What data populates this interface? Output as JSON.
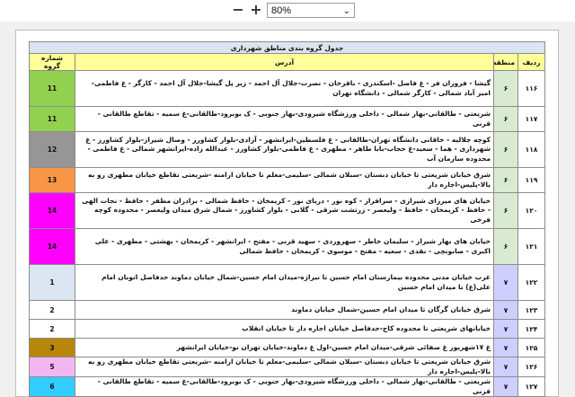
{
  "toolbar": {
    "zoom_out": "−",
    "zoom_in": "+",
    "zoom_value": "80%",
    "caret": "⌄"
  },
  "table": {
    "title": "جدول گروه بندی مناطق شهرداری",
    "headers": {
      "row": "ردیف",
      "region": "منطقه",
      "address": "آدرس",
      "group": "شماره گروه"
    },
    "rows": [
      {
        "code": "۱۱۶",
        "region": "۶",
        "address": "گیشا - فروزان فر - غ فاضل -اسکندری - باقرخان - نصرت-جلال آل احمد - زیر پل گیشا-جلال آل احمد - کارگر - غ فاطمی-امیر آباد شمالی - کارگر شمالی - دانشگاه تهران",
        "group": "11",
        "color": "#92d050",
        "regionColor": "#d9ead3"
      },
      {
        "code": "۱۱۷",
        "region": "۶",
        "address": "شریعتی - طالقانی-بهار شمالی - داخلی ورزشگاه شیرودی-بهار جنوبی - ک بوبرود-طالقانی-غ سمیه - تقاطع طالقانی - قرنی",
        "group": "11",
        "color": "#92d050",
        "regionColor": "#d9ead3"
      },
      {
        "code": "۱۱۸",
        "region": "۶",
        "address": "کوچه جلالیه - خاقانی دانشگاه تهران-طالقانی - غ فلسطین-ایرانشهر - آزادی-بلوار کشاورز - وصال شیراز-بلوار کشاورز - غ شهرداری - هما - سعید-غ حجاب-بابا طاهر - مطهری - غ فاطمی-بلوار کشاورز - عبدالله زاده-ایرانشهر شمالی - غ فاطمی - محدوده سازمان آب",
        "group": "12",
        "color": "#969696",
        "regionColor": "#d9ead3"
      },
      {
        "code": "۱۱۹",
        "region": "۶",
        "address": "شرق خیابان شریعتی تا خیابان دبستان -سبلان شمالی -سلیمی-معلم تا خیابان ارامنه -شریعتی تقاطع خیابان مطهری رو به بالا-پلیس-اجاره دار",
        "group": "13",
        "color": "#f79646",
        "regionColor": "#d9ead3"
      },
      {
        "code": "۱۲۰",
        "region": "۶",
        "address": "خیابان های میرزای شیرازی - سرافراز - کوه نور - دریای نور - کریمخان - حافظ شمالی - برادران مظفر - حافظ - نجات الهی - حافظ - کریمخان - حافظ - ولیعصر - زرتشت شرقی - گلابی - بلوار کشاورز - شمال شرق میدان ولیعصر - محدوده کوچه فرخی",
        "group": "14",
        "color": "#ff00ff",
        "regionColor": "#d9ead3"
      },
      {
        "code": "۱۲۱",
        "region": "۶",
        "address": "خیابان های بهار شیراز - سلیمان خاطر - سهروردی - سهید قرنی - مفتح - ایرانشهر - کریمخان - بهشتی - مطهری - علی اکبری - صابونچی - نقدی - سعیه - مفتح - موسوی - کریمخان - حافظ شمالی",
        "group": "14",
        "color": "#ff00ff",
        "regionColor": "#d9ead3"
      },
      {
        "code": "۱۲۲",
        "region": "۷",
        "address": "غرب خیابان مدنی محدوده بیمارستان امام حسین تا نیراژه-میدان امام حسین-شمال خیابان دماوند حدفاصل اتوبان امام علی(ع) تا میدان امام حسین",
        "group": "1",
        "color": "#dbe5f1",
        "regionColor": "#cfcfff"
      },
      {
        "code": "۱۲۳",
        "region": "۷",
        "address": "شرق خیابان گرگان تا میدان امام حسین-شمال خیابان دماوند",
        "group": "2",
        "color": "#ffffff",
        "regionColor": "#cfcfff"
      },
      {
        "code": "۱۲۴",
        "region": "۷",
        "address": "خیابانهای شریعتی تا محدوده کاج-حدفاصل خیابان اجاره دار تا خیابان انقلاب",
        "group": "2",
        "color": "#ffffff",
        "regionColor": "#cfcfff"
      },
      {
        "code": "۱۲۵",
        "region": "۷",
        "address": "غ ۱۷شهریور غ صفائی شرقی-میدان امام حسین-اول غ دماوند-خیابان تهران نو-خیابان ایرانشهر",
        "group": "3",
        "color": "#b8860b",
        "regionColor": "#cfcfff"
      },
      {
        "code": "۱۲۶",
        "region": "۷",
        "address": "شرق خیابان شریعتی تا خیابان دبستان -سبلان شمالی -سلیمی-معلم تا خیابان ارامنه -شریعتی تقاطع خیابان مطهری رو به بالا-پلیس-اجاره دار",
        "group": "5",
        "color": "#f4b6f0",
        "regionColor": "#cfcfff"
      },
      {
        "code": "۱۲۷",
        "region": "۷",
        "address": "شریعتی - طالقانی-بهار شمالی - داخلی ورزشگاه شیرودی-بهار جنوبی - ک بوبرود-طالقانی-غ سمیه - تقاطع طالقانی - قرنی",
        "group": "6",
        "color": "#33ccff",
        "regionColor": "#cfcfff"
      }
    ]
  }
}
